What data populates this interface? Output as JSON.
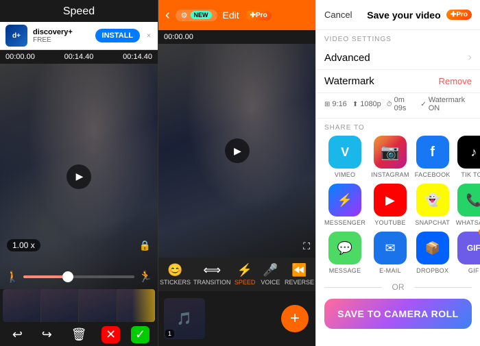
{
  "left_panel": {
    "title": "Speed",
    "ad": {
      "app_name": "discovery+",
      "subtitle": "FREE",
      "install_label": "INSTALL",
      "close": "×"
    },
    "timeline": {
      "start": "00:00.00",
      "mid": "00:14.40",
      "end": "00:14.40"
    },
    "speed_badge": "1.00 x",
    "edit_buttons": {
      "undo": "↩",
      "redo": "↪",
      "delete": "🗑",
      "cancel": "✕",
      "confirm": "✓"
    }
  },
  "middle_panel": {
    "header": {
      "back": "‹",
      "settings_label": "⚙",
      "new_badge": "NEW",
      "edit_label": "Edit",
      "pro_badge": "✚Pro"
    },
    "timeline": {
      "time": "00:00.00"
    },
    "tools": [
      {
        "icon": "😊",
        "label": "STICKERS"
      },
      {
        "icon": "⟺",
        "label": "TRANSITION"
      },
      {
        "icon": "⚡",
        "label": "SPEED"
      },
      {
        "icon": "🎤",
        "label": "VOICE"
      },
      {
        "icon": "⏪",
        "label": "REVERSE"
      }
    ],
    "add_button": "+"
  },
  "right_panel": {
    "header": {
      "cancel_label": "Cancel",
      "title": "Save your video",
      "pro_badge": "✚Pro"
    },
    "video_settings_label": "VIDEO SETTINGS",
    "advanced_label": "Advanced",
    "watermark_label": "Watermark",
    "remove_label": "Remove",
    "meta": {
      "ratio": "9:16",
      "quality": "1080p",
      "duration": "0m 09s",
      "watermark": "Watermark ON"
    },
    "share_to_label": "SHARE TO",
    "share_items": [
      {
        "id": "vimeo",
        "icon": "V",
        "label": "VIMEO",
        "class": "icon-vimeo"
      },
      {
        "id": "instagram",
        "icon": "📸",
        "label": "INSTAGRAM",
        "class": "icon-instagram"
      },
      {
        "id": "facebook",
        "icon": "f",
        "label": "FACEBOOK",
        "class": "icon-facebook"
      },
      {
        "id": "tiktok",
        "icon": "♪",
        "label": "TIK TOK",
        "class": "icon-tiktok"
      },
      {
        "id": "messenger",
        "icon": "⚡",
        "label": "MESSENGER",
        "class": "icon-messenger"
      },
      {
        "id": "youtube",
        "icon": "▶",
        "label": "YOUTUBE",
        "class": "icon-youtube"
      },
      {
        "id": "snapchat",
        "icon": "👻",
        "label": "SNAPCHAT",
        "class": "icon-snapchat"
      },
      {
        "id": "whatsapp",
        "icon": "📞",
        "label": "WHATSAPP",
        "class": "icon-whatsapp"
      },
      {
        "id": "message",
        "icon": "💬",
        "label": "MESSAGE",
        "class": "icon-message"
      },
      {
        "id": "email",
        "icon": "✉",
        "label": "E-MAIL",
        "class": "icon-email"
      },
      {
        "id": "dropbox",
        "icon": "📦",
        "label": "DROPBOX",
        "class": "icon-dropbox"
      },
      {
        "id": "gif",
        "icon": "GIF",
        "label": "GIF",
        "class": "icon-gif",
        "pro": true
      }
    ],
    "or_label": "OR",
    "save_button_label": "SAVE TO CAMERA ROLL"
  }
}
